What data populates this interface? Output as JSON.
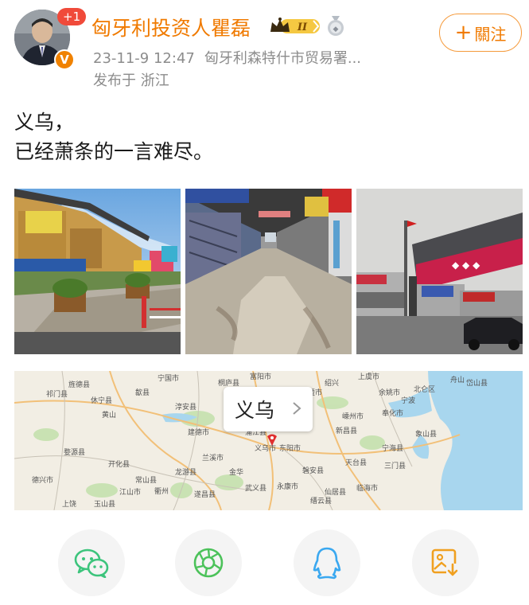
{
  "post": {
    "author": {
      "name": "匈牙利投资人瞿磊",
      "avatar_badge_count": "+1",
      "verified_icon": "v-verified-icon",
      "level_badge": "II"
    },
    "meta": {
      "time": "23-11-9 12:47",
      "source": "匈牙利森特什市贸易署...",
      "location": "发布于 浙江"
    },
    "follow_label": "關注",
    "text_lines": [
      "义乌，",
      "已经萧条的一言难尽。"
    ],
    "map": {
      "place": "义乌",
      "labels": [
        "富阳市",
        "绍兴",
        "上虞市",
        "余姚市",
        "宁波",
        "舟山",
        "岱山县",
        "北仑区",
        "象山县",
        "奉化市",
        "宁海县",
        "三门县",
        "天台县",
        "临海市",
        "仙居县",
        "磐安县",
        "东阳市",
        "义乌市",
        "金华",
        "武义县",
        "永康市",
        "兰溪市",
        "衢州",
        "龙游县",
        "开化县",
        "淳安县",
        "建德市",
        "浦江县",
        "桐庐县",
        "诸暨市",
        "嵊州市",
        "新昌县",
        "黄山",
        "祁门县",
        "休宁县",
        "婺源县",
        "德兴市",
        "江山市",
        "常山县",
        "遂昌县",
        "缙云县",
        "上饶",
        "玉山县",
        "歙县",
        "旌德县",
        "宁国市"
      ]
    }
  },
  "share": {
    "wechat_icon": "wechat-icon",
    "moments_icon": "moments-icon",
    "qq_icon": "qq-icon",
    "save_icon": "save-image-icon"
  },
  "colors": {
    "accent": "#f07a00",
    "meta_gray": "#8c8c8c",
    "badge_red": "#f04a3a",
    "wechat_green": "#3cc47c",
    "moments_green": "#4cc25a",
    "qq_blue": "#3aa8f0",
    "save_orange": "#f0a020"
  }
}
